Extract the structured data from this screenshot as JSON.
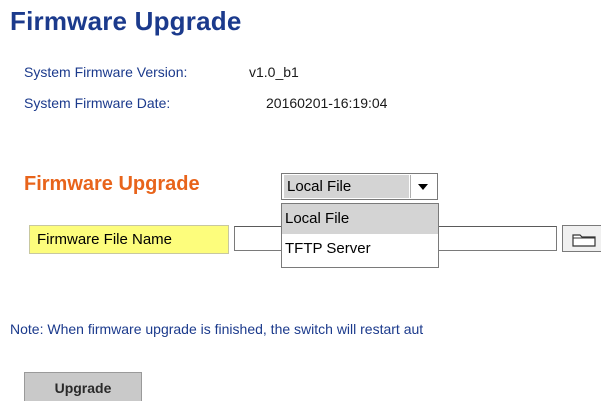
{
  "page": {
    "title": "Firmware Upgrade"
  },
  "info": {
    "version_label": "System Firmware Version:",
    "version_value": "v1.0_b1",
    "date_label": "System Firmware Date:",
    "date_value": "20160201-16:19:04"
  },
  "upgrade": {
    "section_title": "Firmware Upgrade",
    "source_selected": "Local File",
    "source_options": [
      "Local File",
      "TFTP Server"
    ],
    "file_label": "Firmware File Name",
    "file_value": ""
  },
  "note": "Note: When firmware upgrade is finished, the switch will restart aut",
  "actions": {
    "upgrade_label": "Upgrade"
  },
  "colors": {
    "title": "#1b3a8c",
    "section_title": "#e8641b",
    "label_highlight": "#fdfd7c",
    "button": "#c9c9c9"
  },
  "icons": {
    "browse": "folder-icon",
    "dropdown": "chevron-down-icon"
  }
}
